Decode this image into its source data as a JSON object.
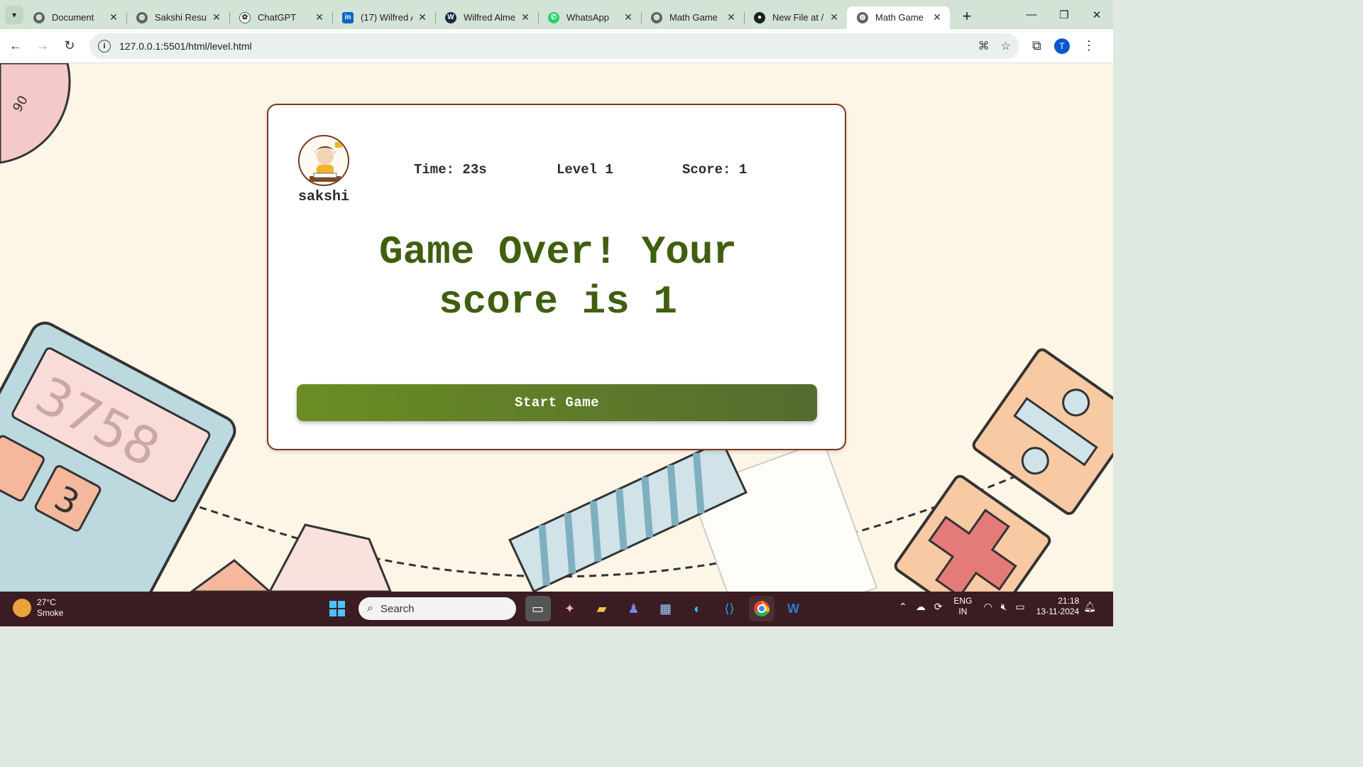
{
  "browser": {
    "tabs": [
      {
        "title": "Document",
        "icon": "globe-icon",
        "active": false
      },
      {
        "title": "Sakshi Resum",
        "icon": "globe-icon",
        "active": false
      },
      {
        "title": "ChatGPT",
        "icon": "chatgpt-icon",
        "active": false
      },
      {
        "title": "(17) Wilfred A",
        "icon": "linkedin-icon",
        "active": false
      },
      {
        "title": "Wilfred Alme",
        "icon": "w-icon",
        "active": false
      },
      {
        "title": "WhatsApp",
        "icon": "whatsapp-icon",
        "active": false
      },
      {
        "title": "Math Game",
        "icon": "globe-icon",
        "active": false
      },
      {
        "title": "New File at /",
        "icon": "github-icon",
        "active": false
      },
      {
        "title": "Math Game",
        "icon": "globe-icon",
        "active": true
      }
    ],
    "url": "127.0.0.1:5501/html/level.html",
    "profile_initial": "T"
  },
  "game": {
    "username": "sakshi",
    "time": "Time: 23s",
    "level": "Level 1",
    "score": "Score: 1",
    "message": "Game Over! Your score is 1",
    "start_button": "Start Game"
  },
  "taskbar": {
    "weather_temp": "27°C",
    "weather_desc": "Smoke",
    "search_placeholder": "Search",
    "lang_line1": "ENG",
    "lang_line2": "IN",
    "time": "21:18",
    "date": "13-11-2024"
  },
  "colors": {
    "card_border": "#7a3a22",
    "message_color": "#3f5f0f",
    "button_start": "#6a8e23",
    "button_end": "#556b2f",
    "page_bg": "#fdf6e7",
    "taskbar_bg": "#3a1c22"
  }
}
